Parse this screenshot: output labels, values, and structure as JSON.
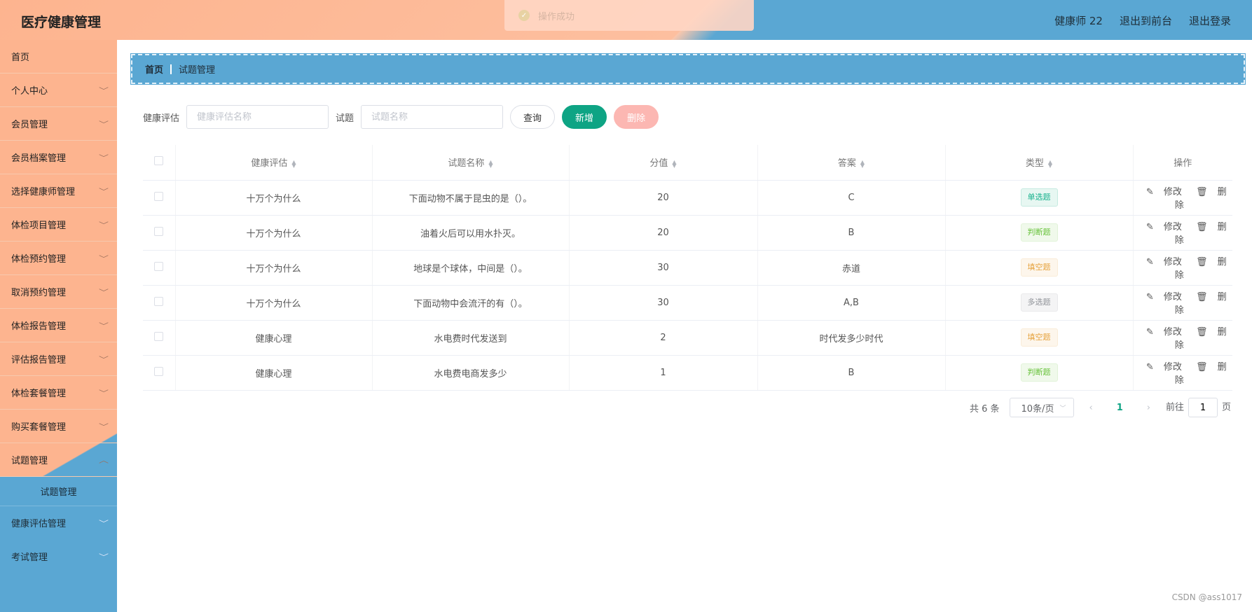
{
  "app": {
    "title": "医疗健康管理",
    "toast": "操作成功",
    "user": "健康师 22",
    "to_front": "退出到前台",
    "logout": "退出登录"
  },
  "sidebar": {
    "items": [
      {
        "label": "首页",
        "has_children": false
      },
      {
        "label": "个人中心",
        "has_children": true
      },
      {
        "label": "会员管理",
        "has_children": true
      },
      {
        "label": "会员档案管理",
        "has_children": true
      },
      {
        "label": "选择健康师管理",
        "has_children": true
      },
      {
        "label": "体检项目管理",
        "has_children": true
      },
      {
        "label": "体检预约管理",
        "has_children": true
      },
      {
        "label": "取消预约管理",
        "has_children": true
      },
      {
        "label": "体检报告管理",
        "has_children": true
      },
      {
        "label": "评估报告管理",
        "has_children": true
      },
      {
        "label": "体检套餐管理",
        "has_children": true
      },
      {
        "label": "购买套餐管理",
        "has_children": true
      },
      {
        "label": "试题管理",
        "has_children": true,
        "open": true,
        "children": [
          "试题管理"
        ]
      },
      {
        "label": "健康评估管理",
        "has_children": true
      },
      {
        "label": "考试管理",
        "has_children": true
      }
    ]
  },
  "breadcrumb": {
    "home": "首页",
    "current": "试题管理"
  },
  "search": {
    "assessment_label": "健康评估",
    "assessment_placeholder": "健康评估名称",
    "question_label": "试题",
    "question_placeholder": "试题名称",
    "query_btn": "查询",
    "add_btn": "新增",
    "delete_btn": "删除"
  },
  "table": {
    "headers": [
      "健康评估",
      "试题名称",
      "分值",
      "答案",
      "类型",
      "操作"
    ],
    "edit_label": "修改",
    "delete_label": "删除",
    "rows": [
      {
        "assessment": "十万个为什么",
        "name": "下面动物不属于昆虫的是（）。",
        "score": "20",
        "answer": "C",
        "type": "单选题",
        "tag_color": "#18b28d"
      },
      {
        "assessment": "十万个为什么",
        "name": "油着火后可以用水扑灭。",
        "score": "20",
        "answer": "B",
        "type": "判断题",
        "tag_color": "#67c23a"
      },
      {
        "assessment": "十万个为什么",
        "name": "地球是个球体，中间是（）。",
        "score": "30",
        "answer": "赤道",
        "type": "填空题",
        "tag_color": "#e6a23c"
      },
      {
        "assessment": "十万个为什么",
        "name": "下面动物中会流汗的有（）。",
        "score": "30",
        "answer": "A,B",
        "type": "多选题",
        "tag_color": "#909399"
      },
      {
        "assessment": "健康心理",
        "name": "水电费时代发送到",
        "score": "2",
        "answer": "时代发多少时代",
        "type": "填空题",
        "tag_color": "#e6a23c"
      },
      {
        "assessment": "健康心理",
        "name": "水电费电商发多少",
        "score": "1",
        "answer": "B",
        "type": "判断题",
        "tag_color": "#67c23a"
      }
    ]
  },
  "pagination": {
    "total": "共 6 条",
    "page_size": "10条/页",
    "current_page": "1",
    "goto_label": "前往",
    "goto_value": "1",
    "page_unit": "页"
  },
  "watermark": "CSDN @ass1017"
}
